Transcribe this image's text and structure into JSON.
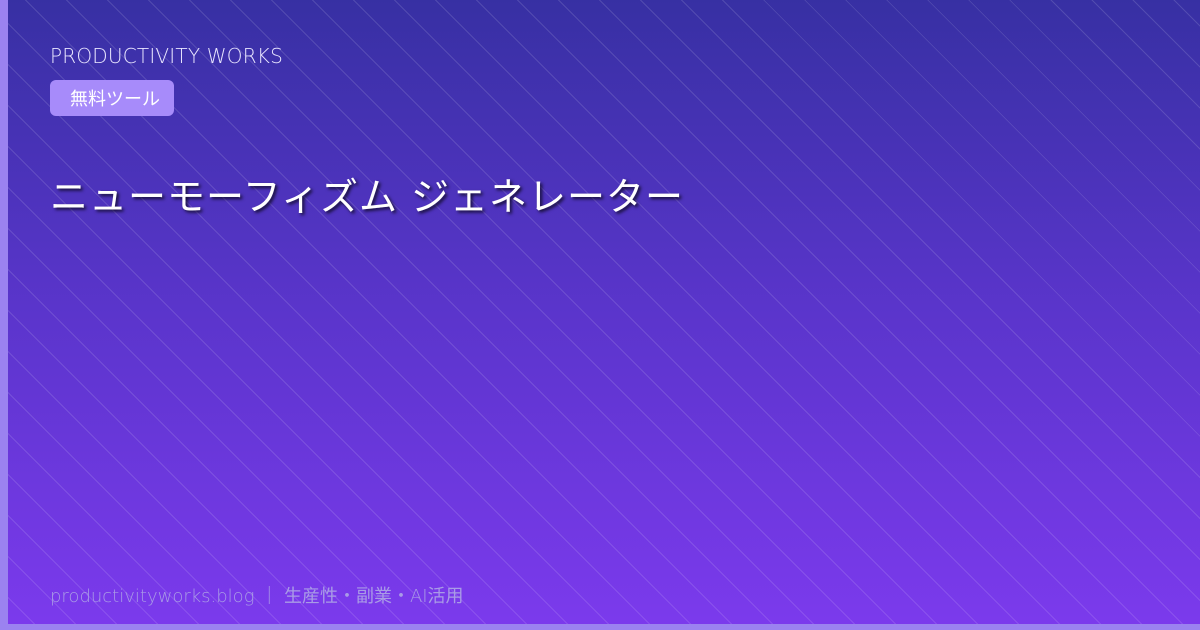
{
  "brand": "PRODUCTIVITY WORKS",
  "badge": "無料ツール",
  "title": "ニューモーフィズム ジェネレーター",
  "footer": "productivityworks.blog ｜ 生産性・副業・AI活用",
  "colors": {
    "gradient_top": "#3730a3",
    "gradient_bottom": "#7c3aed",
    "accent": "#a78bfa",
    "edge_bar": "#9b82f0",
    "footer_text": "#a99be6"
  }
}
